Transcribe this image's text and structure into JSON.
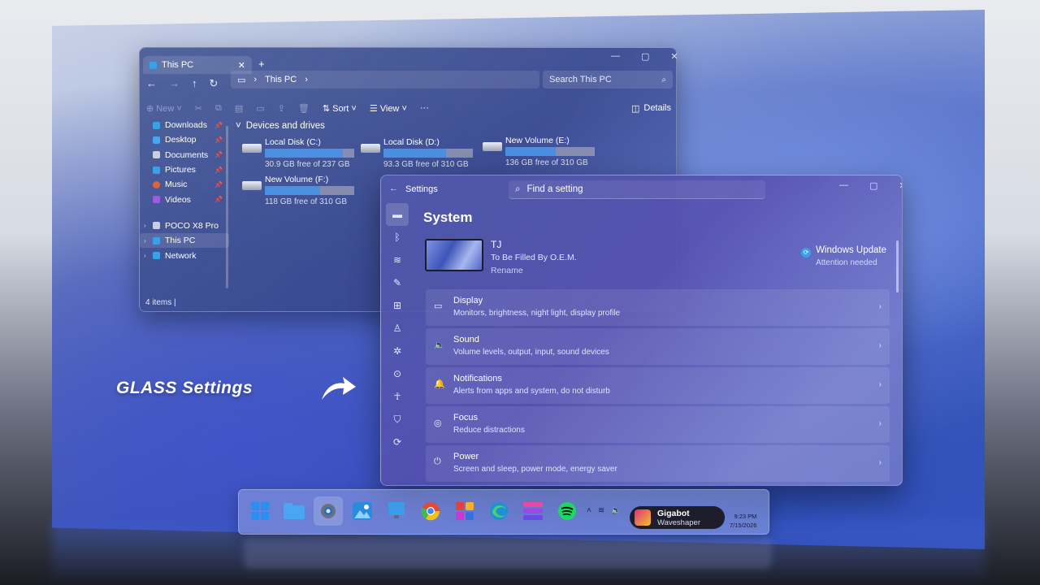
{
  "explorer": {
    "tab_title": "This PC",
    "new_tab": "+",
    "address_crumb": "This PC",
    "search_placeholder": "Search This PC",
    "toolbar": {
      "new": "New",
      "sort": "Sort",
      "view": "View",
      "more": "···",
      "details": "Details"
    },
    "sidebar": {
      "quick": [
        {
          "label": "Downloads",
          "color": "#3aa0e8"
        },
        {
          "label": "Desktop",
          "color": "#47a6f0"
        },
        {
          "label": "Documents",
          "color": "#c9cfe0"
        },
        {
          "label": "Pictures",
          "color": "#3aa0e8"
        },
        {
          "label": "Music",
          "color": "#e0613c"
        },
        {
          "label": "Videos",
          "color": "#9b5be6"
        }
      ],
      "locations": [
        {
          "label": "POCO X8 Pro",
          "color": "#c9cfe0"
        },
        {
          "label": "This PC",
          "color": "#3aa0e8"
        },
        {
          "label": "Network",
          "color": "#3aa0e8"
        }
      ]
    },
    "group_title": "Devices and drives",
    "drives": [
      {
        "name": "Local Disk (C:)",
        "free": "30.9 GB free of 237 GB",
        "used_fraction": 0.87
      },
      {
        "name": "Local Disk (D:)",
        "free": "93.3 GB free of 310 GB",
        "used_fraction": 0.7
      },
      {
        "name": "New Volume (E:)",
        "free": "136 GB free of 310 GB",
        "used_fraction": 0.56
      },
      {
        "name": "New Volume (F:)",
        "free": "118 GB free of 310 GB",
        "used_fraction": 0.62
      }
    ],
    "status": "4 items"
  },
  "settings": {
    "window_title": "Settings",
    "search_placeholder": "Find a setting",
    "heading": "System",
    "device": {
      "name": "TJ",
      "oem": "To Be Filled By O.E.M.",
      "rename": "Rename"
    },
    "update": {
      "title": "Windows Update",
      "status": "Attention needed"
    },
    "items": [
      {
        "title": "Display",
        "desc": "Monitors, brightness, night light, display profile",
        "icon": "▭"
      },
      {
        "title": "Sound",
        "desc": "Volume levels, output, input, sound devices",
        "icon": "🔈"
      },
      {
        "title": "Notifications",
        "desc": "Alerts from apps and system, do not disturb",
        "icon": "🔔"
      },
      {
        "title": "Focus",
        "desc": "Reduce distractions",
        "icon": "◎"
      },
      {
        "title": "Power",
        "desc": "Screen and sleep, power mode, energy saver",
        "icon": "⏻"
      }
    ]
  },
  "caption": "GLASS Settings",
  "taskbar": {
    "media": {
      "title": "Gigabot",
      "artist": "Waveshaper"
    },
    "clock": {
      "time": "9:23 PM",
      "date": "7/15/2026"
    }
  }
}
